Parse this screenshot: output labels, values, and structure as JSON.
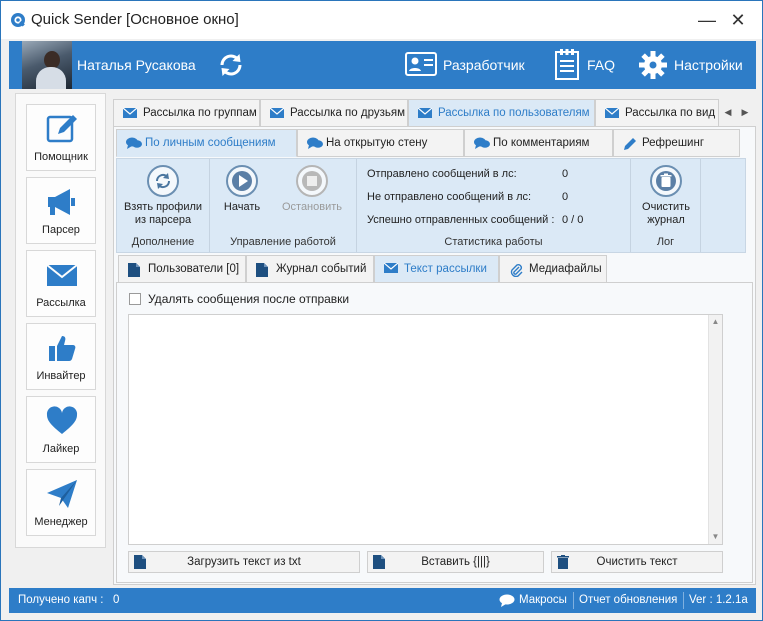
{
  "window": {
    "title": "Quick Sender [Основное окно]",
    "minimize": "—",
    "close": "✕"
  },
  "header": {
    "user_name": "Наталья Русакова",
    "developer": "Разработчик",
    "faq": "FAQ",
    "settings": "Настройки"
  },
  "sidebar": {
    "items": [
      {
        "label": "Помощник",
        "icon": "pencil-icon"
      },
      {
        "label": "Парсер",
        "icon": "megaphone-icon"
      },
      {
        "label": "Рассылка",
        "icon": "envelope-icon"
      },
      {
        "label": "Инвайтер",
        "icon": "thumbs-up-icon"
      },
      {
        "label": "Лайкер",
        "icon": "heart-icon"
      },
      {
        "label": "Менеджер",
        "icon": "paper-plane-icon"
      }
    ]
  },
  "tabs_main": {
    "items": [
      "Рассылка по группам",
      "Рассылка по друзьям",
      "Рассылка по пользователям",
      "Рассылка по вид"
    ],
    "active": 2,
    "prev_arrow": "◀",
    "next_arrow": "▶"
  },
  "tabs_mode": {
    "items": [
      "По личным сообщениям",
      "На открытую стену",
      "По комментариям",
      "Рефрешинг"
    ],
    "active": 0
  },
  "ribbon": {
    "addition": {
      "button": "Взять профили из парсера",
      "group": "Дополнение"
    },
    "control": {
      "start": "Начать",
      "stop": "Остановить",
      "group": "Управление работой"
    },
    "stats": {
      "sent_label": "Отправлено сообщений в лс:",
      "sent_value": "0",
      "not_sent_label": "Не отправлено сообщений в лс:",
      "not_sent_value": "0",
      "success_label": "Успешно отправленных сообщений :",
      "success_value": "0 / 0",
      "group": "Статистика работы"
    },
    "log": {
      "button": "Очистить журнал",
      "group": "Лог"
    }
  },
  "tabs_content": {
    "items": [
      "Пользователи [0]",
      "Журнал событий",
      "Текст рассылки",
      "Медиафайлы"
    ],
    "active": 2
  },
  "message": {
    "delete_after_send": "Удалять сообщения после отправки",
    "delete_after_send_checked": false,
    "text": "",
    "load_txt": "Загрузить текст из txt",
    "insert": "Вставить {|||}",
    "clear": "Очистить текст"
  },
  "status": {
    "captcha_label": "Получено капч :",
    "captcha_value": "0",
    "macros": "Макросы",
    "changelog": "Отчет обновления",
    "version": "Ver : 1.2.1a"
  },
  "colors": {
    "accent": "#2e7dc8",
    "ribbon": "#dbe9f6",
    "active_tab_text": "#2e7dc8"
  }
}
